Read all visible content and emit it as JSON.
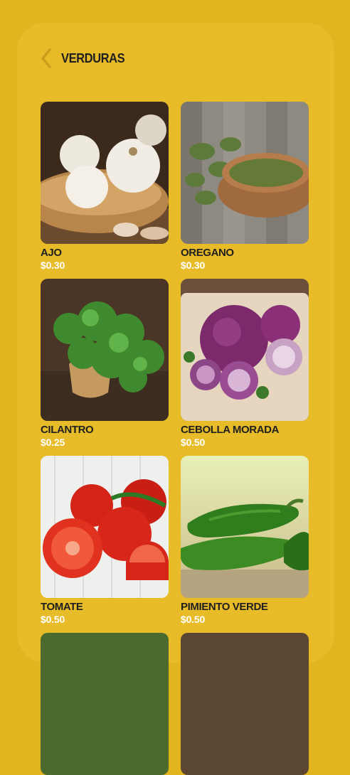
{
  "header": {
    "title": "VERDURAS",
    "back_icon": "chevron-left-icon"
  },
  "products": [
    {
      "name": "AJO",
      "price": "$0.30"
    },
    {
      "name": "OREGANO",
      "price": "$0.30"
    },
    {
      "name": "CILANTRO",
      "price": "$0.25"
    },
    {
      "name": "CEBOLLA MORADA",
      "price": "$0.50"
    },
    {
      "name": "TOMATE",
      "price": "$0.50"
    },
    {
      "name": "PIMIENTO VERDE",
      "price": "$0.50"
    }
  ],
  "colors": {
    "background": "#E1B51F",
    "panel": "#E8BC29",
    "price_text": "#FFFFFF",
    "name_text": "#1F1F1F"
  }
}
